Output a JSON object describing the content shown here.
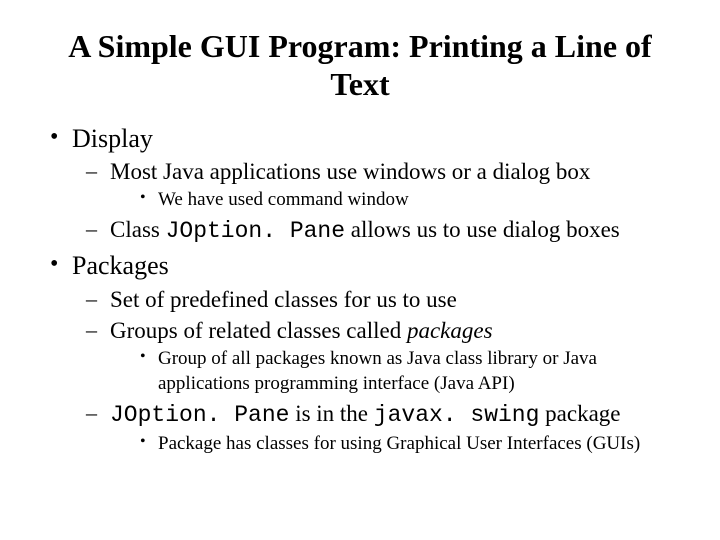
{
  "title": "A Simple GUI  Program: Printing a Line of Text",
  "b1": {
    "label": "Display",
    "s1": "Most Java applications use windows or a dialog box",
    "s1a": "We have used command window",
    "s2_pre": "Class ",
    "s2_code": "JOption. Pane",
    "s2_post": " allows us to use dialog boxes"
  },
  "b2": {
    "label": "Packages",
    "s1": "Set of predefined classes for us to use",
    "s2_pre": "Groups of related classes called ",
    "s2_ital": "packages",
    "s2a": "Group of all packages known as Java class library or Java applications programming interface (Java API)",
    "s3_code1": "JOption. Pane",
    "s3_mid": " is in the ",
    "s3_code2": "javax. swing",
    "s3_post": " package",
    "s3a": "Package has classes for using Graphical User Interfaces (GUIs)"
  }
}
